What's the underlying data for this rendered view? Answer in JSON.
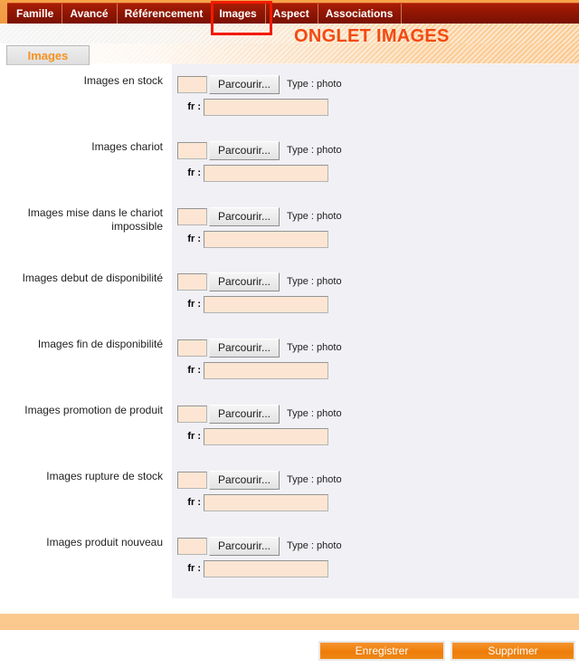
{
  "topbar": {
    "tabs": [
      {
        "label": "Famille",
        "active": false
      },
      {
        "label": "Avancé",
        "active": false
      },
      {
        "label": "Référencement",
        "active": false
      },
      {
        "label": "Images",
        "active": true
      },
      {
        "label": "Aspect",
        "active": false
      },
      {
        "label": "Associations",
        "active": false
      }
    ]
  },
  "header": {
    "annotation_title": "ONGLET IMAGES",
    "subtab_label": "Images"
  },
  "form": {
    "browse_label": "Parcourir...",
    "type_label": "Type : photo",
    "lang_label": "fr :",
    "field_value": "",
    "rows": [
      {
        "label": "Images en stock"
      },
      {
        "label": "Images chariot"
      },
      {
        "label": "Images mise dans le chariot impossible"
      },
      {
        "label": "Images debut de disponibilité"
      },
      {
        "label": "Images fin de disponibilité"
      },
      {
        "label": "Images promotion de produit"
      },
      {
        "label": "Images rupture de stock"
      },
      {
        "label": "Images produit nouveau"
      }
    ]
  },
  "footer": {
    "save_label": "Enregistrer",
    "delete_label": "Supprimer"
  },
  "colors": {
    "tab_bar": "#8c1504",
    "top_band": "#f3a04a",
    "accent_orange": "#f24a12",
    "subtab_text": "#f59320",
    "highlight_red": "#f21b00",
    "panel_bg": "#f0f0f5",
    "input_bg": "#fce6d3",
    "button_orange": "#ee7d09",
    "footer_bar": "#fbc88e"
  }
}
